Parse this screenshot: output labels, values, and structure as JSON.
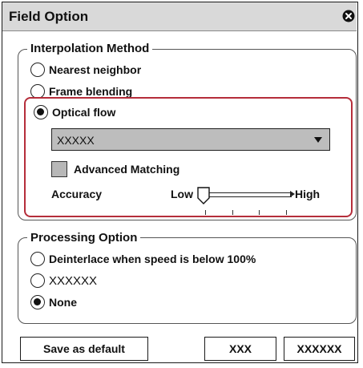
{
  "window": {
    "title": "Field Option"
  },
  "interpolation": {
    "group_title": "Interpolation Method",
    "options": [
      "Nearest neighbor",
      "Frame blending",
      "Optical flow"
    ],
    "selected": "Optical flow",
    "dropdown_value": "XXXXX",
    "advanced_matching_label": "Advanced Matching",
    "accuracy_label": "Accuracy",
    "low_label": "Low",
    "high_label": "High"
  },
  "processing": {
    "group_title": "Processing Option",
    "options": [
      "Deinterlace when speed is below 100%",
      "XXXXXX",
      "None"
    ],
    "selected": "None"
  },
  "footer": {
    "save_default_label": "Save as default",
    "btn1_label": "XXX",
    "btn2_label": "XXXXXX"
  },
  "colors": {
    "highlight": "#b52d3a",
    "titlebar": "#d9d9d9",
    "dropdown": "#bdbdbd"
  }
}
